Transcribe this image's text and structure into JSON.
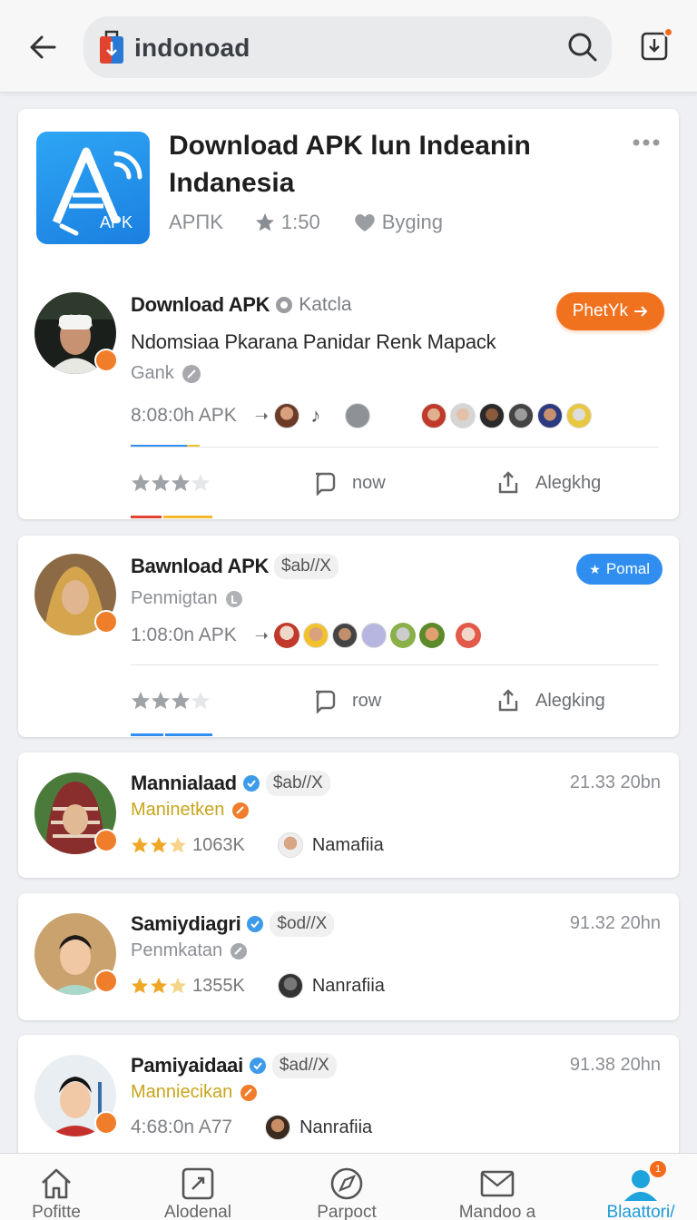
{
  "search": {
    "query": "indonoad"
  },
  "app": {
    "title": "Download APK lun Indeanin Indanesia",
    "icon_label": "APK",
    "category": "APΠK",
    "rating": "1:50",
    "likes": "Byging"
  },
  "posts": [
    {
      "name": "Download APK",
      "tag": "Katcla",
      "description": "Ndomsiaa Pkarana Panidar Renk Mapack",
      "sub": "Gank",
      "time": "8:08:0h APK",
      "button": "PhetYk",
      "comment_label": "now",
      "share_label": "Alegkhg"
    },
    {
      "name": "Bawnload APK",
      "tag": "$ab//X",
      "sub": "Penmigtan",
      "time": "1:08:0n APK",
      "button": "Pomal",
      "comment_label": "row",
      "share_label": "Alegking"
    },
    {
      "name": "Mannialaad",
      "tag": "$ab//X",
      "sub": "Maninetken",
      "time": "21.33 20bn",
      "count": "1063K",
      "user": "Namafiia"
    },
    {
      "name": "Samiydiagri",
      "tag": "$od//X",
      "sub": "Penmkatan",
      "time": "91.32 20hn",
      "count": "1355K",
      "user": "Nanrafiia"
    },
    {
      "name": "Pamiyaidaai",
      "tag": "$ad//X",
      "sub": "Manniecikan",
      "time": "91.38 20hn",
      "meta": "4:68:0n A77",
      "user": "Nanrafiia"
    }
  ],
  "nav": [
    {
      "label": "Pofitte"
    },
    {
      "label": "Alodenal"
    },
    {
      "label": "Parpoct"
    },
    {
      "label": "Mandoo a"
    },
    {
      "label": "Blaattori/",
      "badge": "1"
    }
  ],
  "colors": {
    "accent_orange": "#f0711e",
    "accent_blue": "#2f8ef0",
    "nav_active": "#1f9ad6"
  }
}
